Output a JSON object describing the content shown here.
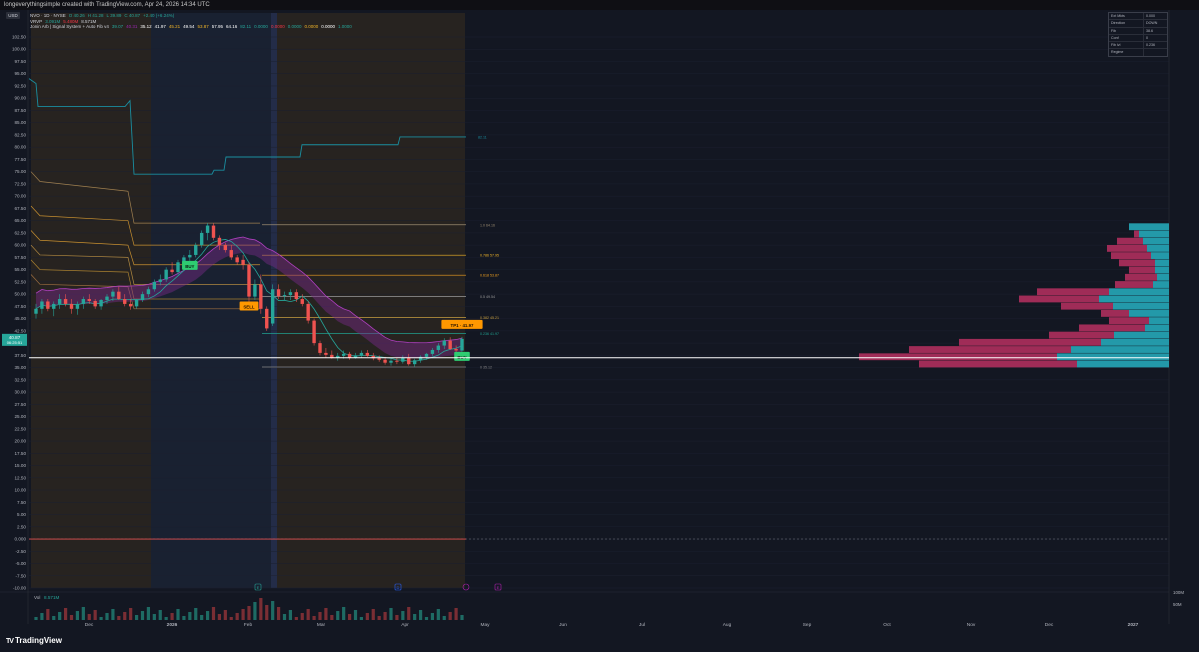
{
  "banner": "longeverythingsimple created with TradingView.com, Apr 24, 2026 14:34 UTC",
  "currency": "USD",
  "legend": {
    "line1": [
      {
        "text": "NVO · 1D · NYSE",
        "color": "#d1d4dc"
      },
      {
        "text": "O 40.26",
        "color": "#26a69a"
      },
      {
        "text": "H 41.28",
        "color": "#26a69a"
      },
      {
        "text": "L 39.89",
        "color": "#26a69a"
      },
      {
        "text": "C 40.87",
        "color": "#26a69a"
      },
      {
        "text": "+2.40 (+6.24%)",
        "color": "#26a69a"
      }
    ],
    "line2": [
      {
        "text": "VRVP",
        "color": "#d1d4dc"
      },
      {
        "text": "3.091M",
        "color": "#26a69a"
      },
      {
        "text": "5.480M",
        "color": "#f23645"
      },
      {
        "text": "8.571M",
        "color": "#d1d4dc"
      }
    ],
    "line3": [
      {
        "text": "Jonin Arb | Signal System + Auto Fib v4",
        "color": "#d1d4dc"
      },
      {
        "text": "39.07",
        "color": "#26a69a"
      },
      {
        "text": "40.31",
        "color": "#9c27b0"
      },
      {
        "text": "35.12",
        "color": "#ffffff"
      },
      {
        "text": "41.97",
        "color": "#ffffff"
      },
      {
        "text": "45.21",
        "color": "#f0b429"
      },
      {
        "text": "49.54",
        "color": "#ffffff"
      },
      {
        "text": "53.87",
        "color": "#f0b429"
      },
      {
        "text": "57.95",
        "color": "#ffffff"
      },
      {
        "text": "64.16",
        "color": "#ffffff"
      },
      {
        "text": "82.11",
        "color": "#26a69a"
      },
      {
        "text": "0.0000",
        "color": "#26a69a"
      },
      {
        "text": "0.0000",
        "color": "#f23645"
      },
      {
        "text": "0.0000",
        "color": "#26a69a"
      },
      {
        "text": "0.0000",
        "color": "#f0b429"
      },
      {
        "text": "0.0000",
        "color": "#ffffff"
      },
      {
        "text": "1.0000",
        "color": "#26a69a"
      }
    ]
  },
  "stat_table": [
    {
      "k": "Ext Mkts",
      "v": "0.000"
    },
    {
      "k": "Direction",
      "v": "DOWN"
    },
    {
      "k": "Fib",
      "v": "38.6"
    },
    {
      "k": "Conf",
      "v": "0"
    },
    {
      "k": "Fib lvl",
      "v": "0.236"
    },
    {
      "k": "Regime",
      "v": ""
    }
  ],
  "footer": {
    "logo_mark": "TV",
    "logo_text": "TradingView"
  },
  "chart_data": {
    "type": "candlestick",
    "symbol": "NVO",
    "timeframe": "1D",
    "exchange": "NYSE",
    "ylim": [
      -10,
      102.5
    ],
    "y_ticks": [
      "102.50",
      "100.00",
      "97.50",
      "95.00",
      "92.50",
      "90.00",
      "87.50",
      "85.00",
      "82.50",
      "80.00",
      "77.50",
      "75.00",
      "72.50",
      "70.00",
      "67.50",
      "65.00",
      "62.50",
      "60.00",
      "57.50",
      "55.00",
      "52.50",
      "50.00",
      "47.50",
      "45.00",
      "42.50",
      "40.00",
      "37.50",
      "35.00",
      "32.50",
      "30.00",
      "27.50",
      "25.00",
      "22.50",
      "20.00",
      "17.50",
      "15.00",
      "12.50",
      "10.00",
      "7.50",
      "5.00",
      "2.50",
      "0.000",
      "-2.50",
      "-5.00",
      "-7.50",
      "-10.00"
    ],
    "x_ticks": [
      "Dec",
      "2026",
      "Feb",
      "Mar",
      "Apr",
      "May",
      "Jun",
      "Jul",
      "Aug",
      "Sep",
      "Oct",
      "Nov",
      "Dec",
      "2027"
    ],
    "last_price": "40.87",
    "price_countdown": "06:25:51",
    "horizontal_line": 37.0,
    "candles": [
      [
        46,
        48,
        45,
        47
      ],
      [
        47,
        49,
        46,
        48.5
      ],
      [
        48.5,
        49,
        46.5,
        47
      ],
      [
        47,
        48.5,
        45.5,
        48
      ],
      [
        48,
        50,
        47,
        49
      ],
      [
        49,
        50,
        47.5,
        48
      ],
      [
        48,
        49,
        46,
        47
      ],
      [
        47,
        48.5,
        45.8,
        48
      ],
      [
        48,
        49.5,
        47,
        49
      ],
      [
        49,
        50,
        48,
        48.6
      ],
      [
        48.6,
        49,
        47,
        47.5
      ],
      [
        47.5,
        49,
        46.8,
        48.8
      ],
      [
        48.8,
        50,
        48,
        49.5
      ],
      [
        49.5,
        51,
        48.6,
        50.5
      ],
      [
        50.5,
        51.5,
        48.8,
        49
      ],
      [
        49,
        50,
        47.5,
        48
      ],
      [
        48,
        49,
        46.8,
        47.5
      ],
      [
        47.5,
        49,
        47,
        48.8
      ],
      [
        48.8,
        50.5,
        48.4,
        50
      ],
      [
        50,
        51.5,
        49.4,
        51
      ],
      [
        51,
        53,
        50.5,
        52.5
      ],
      [
        52.5,
        54,
        51.8,
        53
      ],
      [
        53,
        55.5,
        52.5,
        55
      ],
      [
        55,
        56.5,
        54,
        54.5
      ],
      [
        54.5,
        57,
        54,
        56.5
      ],
      [
        56.5,
        58,
        55.5,
        57.5
      ],
      [
        57.5,
        59,
        56.8,
        58
      ],
      [
        58,
        60.5,
        57.5,
        60
      ],
      [
        60,
        63,
        59.5,
        62.5
      ],
      [
        62.5,
        64.5,
        61,
        64
      ],
      [
        64,
        64.5,
        61,
        61.5
      ],
      [
        61.5,
        62,
        59,
        60
      ],
      [
        60,
        60.5,
        58.5,
        59
      ],
      [
        59,
        60,
        57,
        57.5
      ],
      [
        57.5,
        58,
        56,
        56.5
      ],
      [
        57,
        58,
        55,
        56
      ],
      [
        56,
        56.5,
        48.5,
        49.5
      ],
      [
        49.5,
        53,
        48.8,
        52
      ],
      [
        52,
        54,
        46,
        47
      ],
      [
        47,
        47.5,
        42.5,
        43
      ],
      [
        44,
        52,
        43.5,
        51
      ],
      [
        51,
        52,
        49,
        49.6
      ],
      [
        49.6,
        50.5,
        48.8,
        49.8
      ],
      [
        49.8,
        51,
        48.8,
        50.4
      ],
      [
        50.4,
        51,
        48.4,
        49
      ],
      [
        49,
        50,
        47.5,
        48
      ],
      [
        48,
        48.5,
        44,
        44.6
      ],
      [
        44.6,
        45,
        39.5,
        40
      ],
      [
        40,
        40.5,
        37.5,
        38
      ],
      [
        38,
        39,
        37,
        37.6
      ],
      [
        37.6,
        38.5,
        36.8,
        37
      ],
      [
        37,
        38,
        36.4,
        37.4
      ],
      [
        37.4,
        38.5,
        36.8,
        37.8
      ],
      [
        37.8,
        38.2,
        36.6,
        37
      ],
      [
        37,
        38,
        36.8,
        37.5
      ],
      [
        37.5,
        38.5,
        37,
        38
      ],
      [
        38,
        38.6,
        37.2,
        37.4
      ],
      [
        37.4,
        38,
        36.5,
        36.9
      ],
      [
        36.9,
        37.5,
        36.2,
        36.6
      ],
      [
        36.6,
        37.2,
        35.6,
        36
      ],
      [
        36,
        36.8,
        35.4,
        36.4
      ],
      [
        36.4,
        37,
        35.7,
        36.2
      ],
      [
        36.2,
        37.5,
        35.8,
        37
      ],
      [
        37,
        37.8,
        35.4,
        35.7
      ],
      [
        35.7,
        36.8,
        35.2,
        36.5
      ],
      [
        36.5,
        37.5,
        36,
        37.2
      ],
      [
        37.2,
        38,
        36.6,
        37.8
      ],
      [
        37.8,
        39,
        37.4,
        38.6
      ],
      [
        38.6,
        40,
        38,
        39.5
      ],
      [
        39.5,
        41,
        38.8,
        40.5
      ],
      [
        40.5,
        41.2,
        38.6,
        38.8
      ],
      [
        38.8,
        39.5,
        38,
        38.5
      ],
      [
        38.47,
        41.28,
        38.2,
        40.87
      ]
    ],
    "fib_levels": [
      {
        "label": "1.0",
        "value": 64.16
      },
      {
        "label": "0.786",
        "value": 57.95
      },
      {
        "label": "0.618",
        "value": 53.87
      },
      {
        "label": "0.5",
        "value": 49.54
      },
      {
        "label": "0.382",
        "value": 45.21
      },
      {
        "label": "0.236",
        "value": 41.97
      },
      {
        "label": "0",
        "value": 35.12
      }
    ],
    "upper_band_value": 82.11,
    "signal_labels": [
      {
        "text": "BUY"
      },
      {
        "text": "SELL"
      },
      {
        "text": "BUY"
      },
      {
        "text": "TP1 · 41.97"
      }
    ],
    "volume_label": "Vol",
    "volume_value": "8.571M",
    "volume_axis": [
      "100M",
      "50M"
    ],
    "markers": [
      "E",
      "D",
      "E"
    ]
  }
}
